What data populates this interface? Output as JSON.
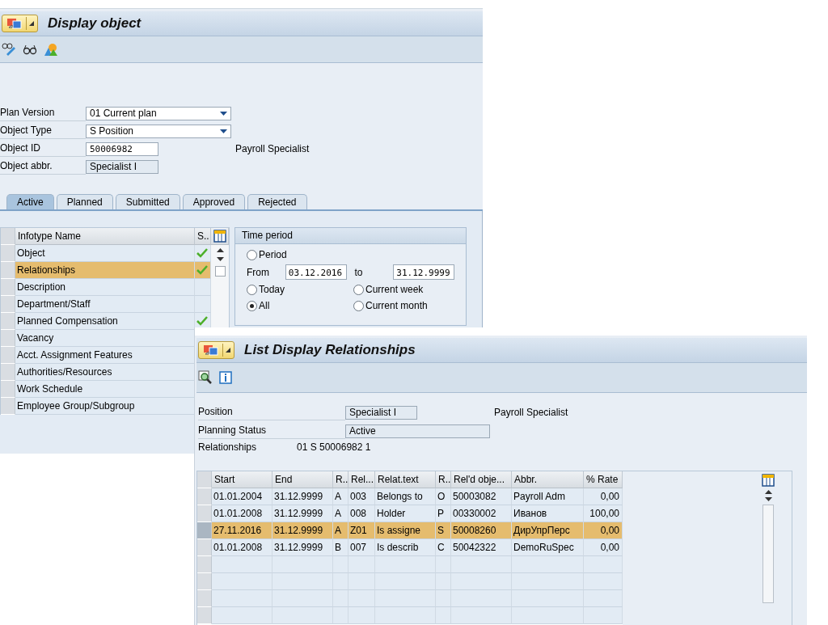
{
  "display_window": {
    "title": "Display object",
    "fields": [
      {
        "label": "Plan Version",
        "value": "01 Current plan",
        "kind": "dropdown"
      },
      {
        "label": "Object Type",
        "value": "S Position",
        "kind": "dropdown"
      },
      {
        "label": "Object ID",
        "value": "50006982",
        "kind": "input",
        "description": "Payroll Specialist"
      },
      {
        "label": "Object abbr.",
        "value": "Specialist I",
        "kind": "readonly"
      }
    ],
    "tabs": [
      {
        "label": "Active",
        "selected": true
      },
      {
        "label": "Planned",
        "selected": false
      },
      {
        "label": "Submitted",
        "selected": false
      },
      {
        "label": "Approved",
        "selected": false
      },
      {
        "label": "Rejected",
        "selected": false
      }
    ],
    "infotype_table": {
      "columns": [
        "Infotype Name",
        "S.."
      ],
      "rows": [
        {
          "name": "Object",
          "done": true,
          "selected": false
        },
        {
          "name": "Relationships",
          "done": true,
          "selected": true
        },
        {
          "name": "Description",
          "done": false,
          "selected": false
        },
        {
          "name": "Department/Staff",
          "done": false,
          "selected": false
        },
        {
          "name": "Planned Compensation",
          "done": true,
          "selected": false
        },
        {
          "name": "Vacancy",
          "done": false,
          "selected": false
        },
        {
          "name": "Acct. Assignment Features",
          "done": false,
          "selected": false
        },
        {
          "name": "Authorities/Resources",
          "done": false,
          "selected": false
        },
        {
          "name": "Work Schedule",
          "done": false,
          "selected": false
        },
        {
          "name": "Employee Group/Subgroup",
          "done": false,
          "selected": false
        }
      ]
    },
    "time_period": {
      "title": "Time period",
      "period_option": {
        "label": "Period",
        "selected": false
      },
      "from_label": "From",
      "from": "03.12.2016",
      "to_label": "to",
      "to": "31.12.9999",
      "options": [
        {
          "label": "Today",
          "selected": false
        },
        {
          "label": "Current week",
          "selected": false
        },
        {
          "label": "All",
          "selected": true
        },
        {
          "label": "Current month",
          "selected": false
        }
      ]
    }
  },
  "relationships_window": {
    "title": "List Display Relationships",
    "position": {
      "label": "Position",
      "value": "Specialist I",
      "description": "Payroll Specialist"
    },
    "planning_status": {
      "label": "Planning Status",
      "value": "Active"
    },
    "relationships": {
      "label": "Relationships",
      "value": "01 S  50006982 1"
    },
    "table": {
      "columns": [
        "Start",
        "End",
        "R..",
        "Rel...",
        "Relat.text",
        "R..",
        "Rel'd obje...",
        "Abbr.",
        "% Rate"
      ],
      "rows": [
        {
          "cells": [
            "01.01.2004",
            "31.12.9999",
            "A",
            "003",
            "Belongs to",
            "O",
            "50003082",
            "Payroll Adm",
            "0,00"
          ],
          "selected": false
        },
        {
          "cells": [
            "01.01.2008",
            "31.12.9999",
            "A",
            "008",
            "Holder",
            "P",
            "00330002",
            "Иванов",
            "100,00"
          ],
          "selected": false
        },
        {
          "cells": [
            "27.11.2016",
            "31.12.9999",
            "A",
            "Z01",
            "Is assigne",
            "S",
            "50008260",
            "ДирУпрПерс",
            "0,00"
          ],
          "selected": true
        },
        {
          "cells": [
            "01.01.2008",
            "31.12.9999",
            "B",
            "007",
            "Is describ",
            "C",
            "50042322",
            "DemoRuSpec",
            "0,00"
          ],
          "selected": false
        }
      ]
    }
  }
}
